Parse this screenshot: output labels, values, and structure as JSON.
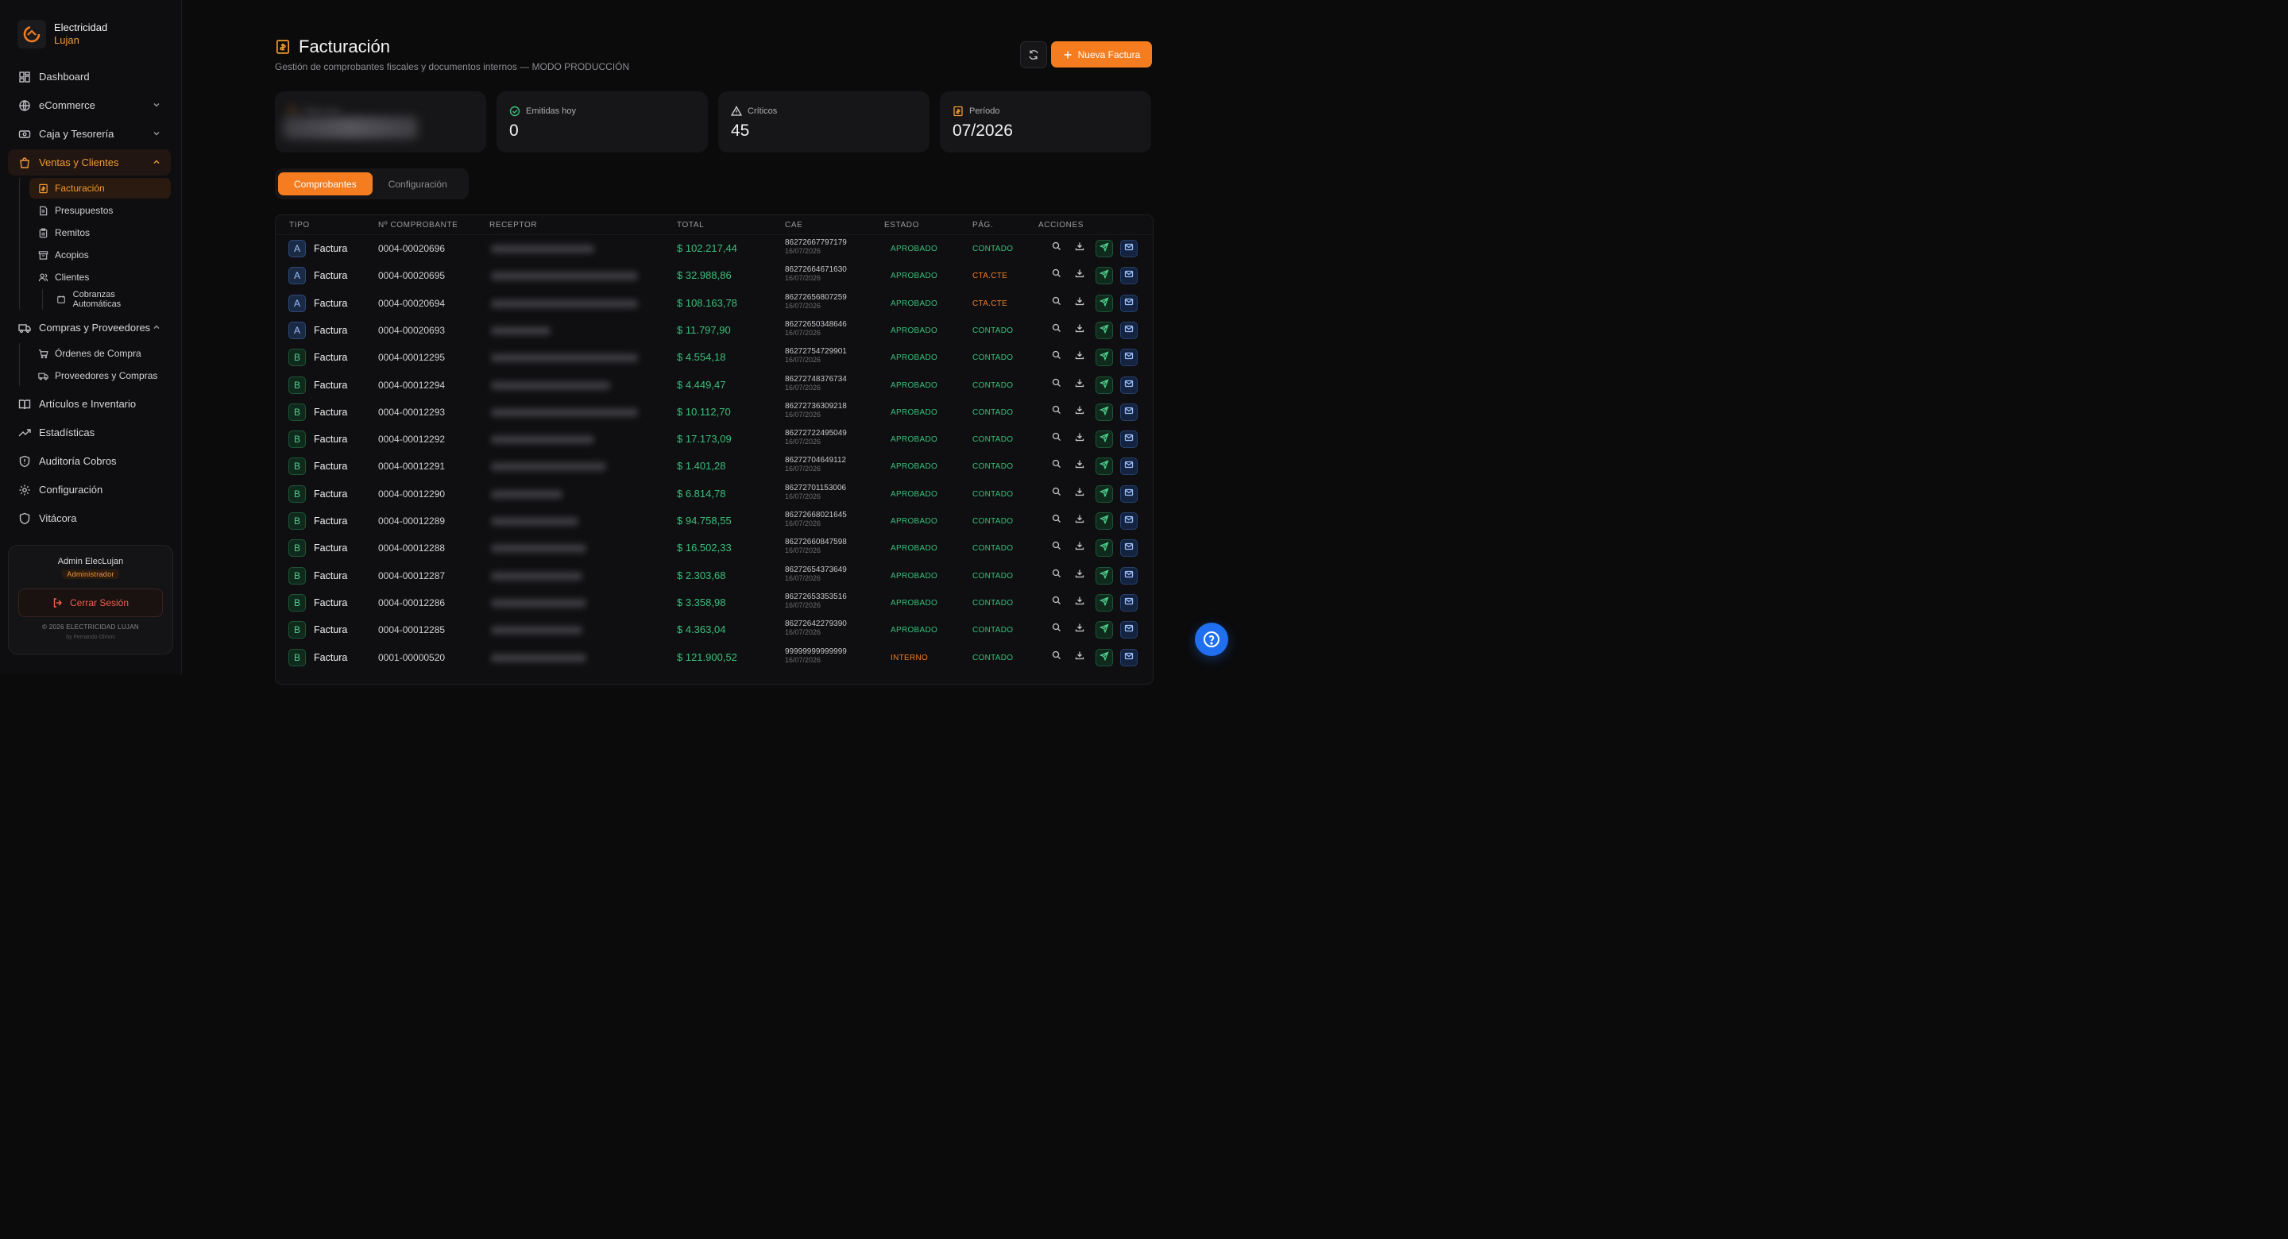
{
  "brand": {
    "name": "Electricidad",
    "sub": "Lujan"
  },
  "nav": {
    "dashboard": "Dashboard",
    "ecommerce": "eCommerce",
    "caja": "Caja y Tesorería",
    "ventas": "Ventas y Clientes",
    "ventas_sub": {
      "facturacion": "Facturación",
      "presupuestos": "Presupuestos",
      "remitos": "Remitos",
      "acopios": "Acopios",
      "clientes": "Clientes",
      "cobranzas": "Cobranzas Automáticas"
    },
    "compras": "Compras y Proveedores",
    "compras_sub": {
      "ordenes": "Órdenes de Compra",
      "proveedores": "Proveedores y Compras"
    },
    "articulos": "Artículos e Inventario",
    "estadisticas": "Estadísticas",
    "auditoria": "Auditoría Cobros",
    "configuracion": "Configuración",
    "vitacora": "Vitácora"
  },
  "user": {
    "name": "Admin ElecLujan",
    "role": "Administrador",
    "logout": "Cerrar Sesión",
    "copyright": "© 2026 ELECTRICIDAD LUJAN",
    "byline": "by Fernando Olmos"
  },
  "header": {
    "title": "Facturación",
    "subtitle": "Gestión de comprobantes fiscales y documentos internos — MODO PRODUCCIÓN",
    "new_button": "Nueva Factura"
  },
  "stats": {
    "total_mes_label": "Total mes",
    "emitidas_label": "Emitidas hoy",
    "emitidas_value": "0",
    "criticos_label": "Críticos",
    "criticos_value": "45",
    "periodo_label": "Período",
    "periodo_value": "07/2026"
  },
  "tabs": {
    "comprobantes": "Comprobantes",
    "configuracion": "Configuración"
  },
  "table": {
    "headers": {
      "tipo": "TIPO",
      "numero": "Nº COMPROBANTE",
      "receptor": "RECEPTOR",
      "total": "TOTAL",
      "cae": "CAE",
      "estado": "ESTADO",
      "pag": "PÁG.",
      "acciones": "ACCIONES"
    },
    "rows": [
      {
        "letter": "A",
        "type": "Factura",
        "number": "0004-00020696",
        "total": "$ 102.217,44",
        "cae": "86272667797179",
        "date": "16/07/2026",
        "estado": "APROBADO",
        "pag": "CONTADO"
      },
      {
        "letter": "A",
        "type": "Factura",
        "number": "0004-00020695",
        "total": "$ 32.988,86",
        "cae": "86272664671630",
        "date": "16/07/2026",
        "estado": "APROBADO",
        "pag": "CTA.CTE"
      },
      {
        "letter": "A",
        "type": "Factura",
        "number": "0004-00020694",
        "total": "$ 108.163,78",
        "cae": "86272656807259",
        "date": "16/07/2026",
        "estado": "APROBADO",
        "pag": "CTA.CTE"
      },
      {
        "letter": "A",
        "type": "Factura",
        "number": "0004-00020693",
        "total": "$ 11.797,90",
        "cae": "86272650348646",
        "date": "16/07/2026",
        "estado": "APROBADO",
        "pag": "CONTADO"
      },
      {
        "letter": "B",
        "type": "Factura",
        "number": "0004-00012295",
        "total": "$ 4.554,18",
        "cae": "86272754729901",
        "date": "16/07/2026",
        "estado": "APROBADO",
        "pag": "CONTADO"
      },
      {
        "letter": "B",
        "type": "Factura",
        "number": "0004-00012294",
        "total": "$ 4.449,47",
        "cae": "86272748376734",
        "date": "16/07/2026",
        "estado": "APROBADO",
        "pag": "CONTADO"
      },
      {
        "letter": "B",
        "type": "Factura",
        "number": "0004-00012293",
        "total": "$ 10.112,70",
        "cae": "86272736309218",
        "date": "16/07/2026",
        "estado": "APROBADO",
        "pag": "CONTADO"
      },
      {
        "letter": "B",
        "type": "Factura",
        "number": "0004-00012292",
        "total": "$ 17.173,09",
        "cae": "86272722495049",
        "date": "16/07/2026",
        "estado": "APROBADO",
        "pag": "CONTADO"
      },
      {
        "letter": "B",
        "type": "Factura",
        "number": "0004-00012291",
        "total": "$ 1.401,28",
        "cae": "86272704649112",
        "date": "16/07/2026",
        "estado": "APROBADO",
        "pag": "CONTADO"
      },
      {
        "letter": "B",
        "type": "Factura",
        "number": "0004-00012290",
        "total": "$ 6.814,78",
        "cae": "86272701153006",
        "date": "16/07/2026",
        "estado": "APROBADO",
        "pag": "CONTADO"
      },
      {
        "letter": "B",
        "type": "Factura",
        "number": "0004-00012289",
        "total": "$ 94.758,55",
        "cae": "86272668021645",
        "date": "16/07/2026",
        "estado": "APROBADO",
        "pag": "CONTADO"
      },
      {
        "letter": "B",
        "type": "Factura",
        "number": "0004-00012288",
        "total": "$ 16.502,33",
        "cae": "86272660847598",
        "date": "16/07/2026",
        "estado": "APROBADO",
        "pag": "CONTADO"
      },
      {
        "letter": "B",
        "type": "Factura",
        "number": "0004-00012287",
        "total": "$ 2.303,68",
        "cae": "86272654373649",
        "date": "16/07/2026",
        "estado": "APROBADO",
        "pag": "CONTADO"
      },
      {
        "letter": "B",
        "type": "Factura",
        "number": "0004-00012286",
        "total": "$ 3.358,98",
        "cae": "86272653353516",
        "date": "16/07/2026",
        "estado": "APROBADO",
        "pag": "CONTADO"
      },
      {
        "letter": "B",
        "type": "Factura",
        "number": "0004-00012285",
        "total": "$ 4.363,04",
        "cae": "86272642279390",
        "date": "16/07/2026",
        "estado": "APROBADO",
        "pag": "CONTADO"
      },
      {
        "letter": "B",
        "type": "Factura",
        "number": "0001-00000520",
        "total": "$ 121.900,52",
        "cae": "99999999999999",
        "date": "16/07/2026",
        "estado": "INTERNO",
        "pag": "CONTADO"
      }
    ]
  },
  "colors": {
    "accent": "#f57c1f",
    "approved": "#37c07b",
    "ctacte": "#f57c1f",
    "interno": "#f57c1f"
  }
}
